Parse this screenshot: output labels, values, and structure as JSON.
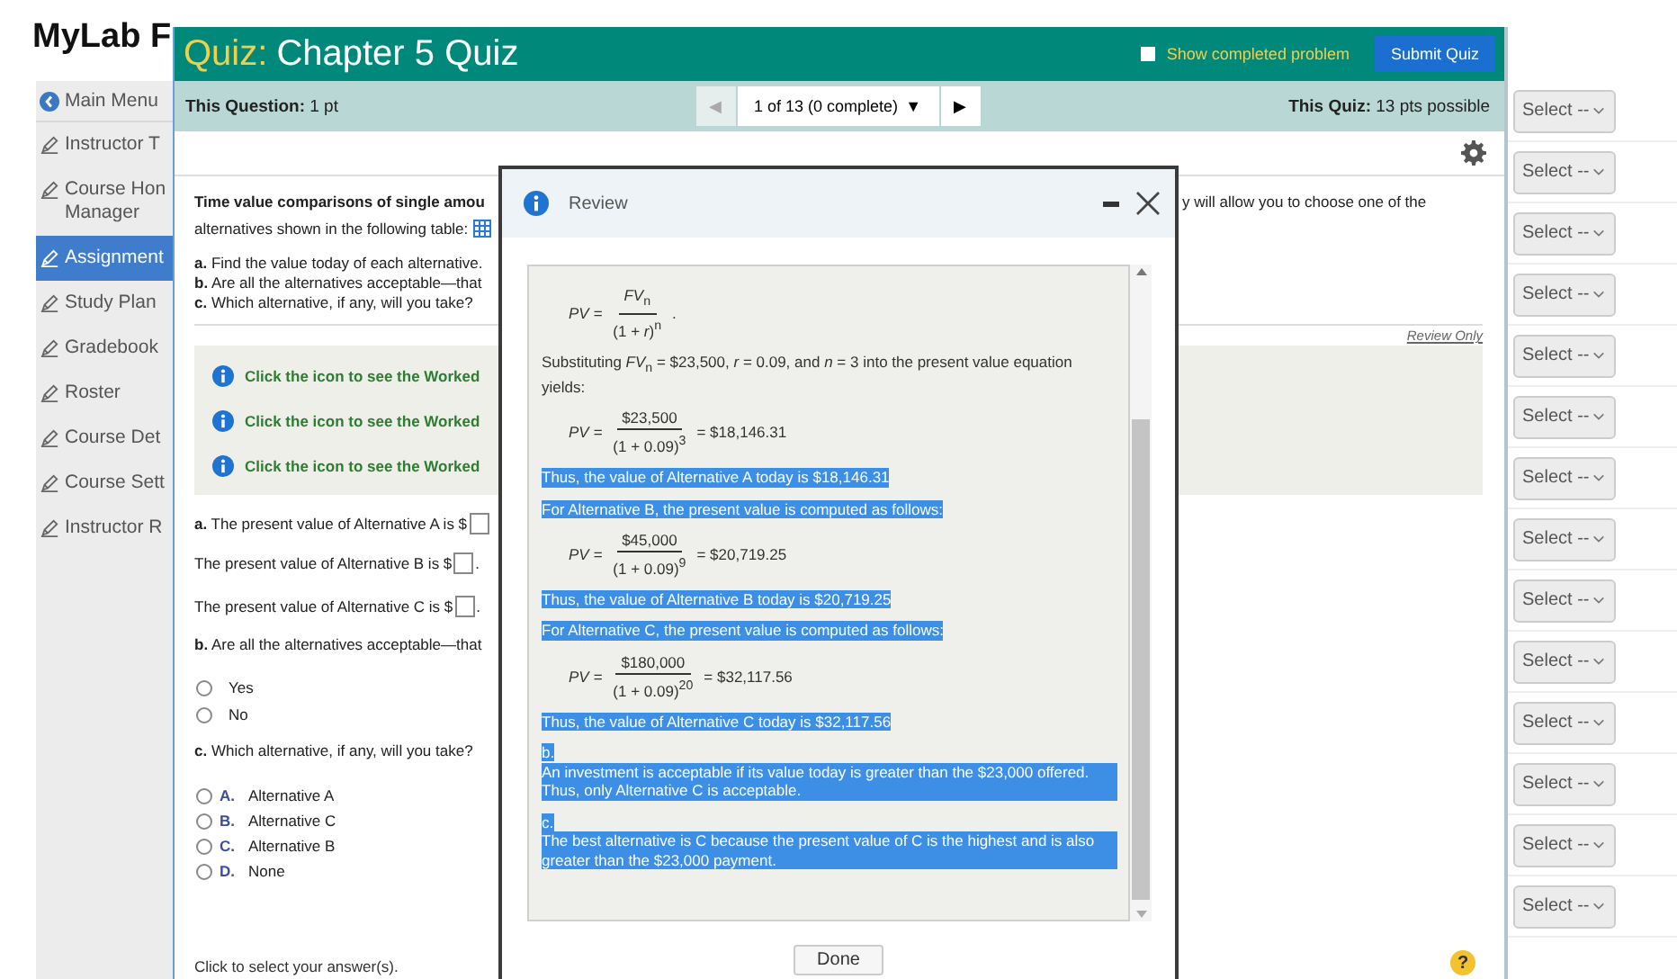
{
  "app": {
    "brand": "MyLab F"
  },
  "sidebar": {
    "items": [
      {
        "kind": "back",
        "label": "Main Menu",
        "selected": false
      },
      {
        "kind": "page",
        "label": "Instructor T",
        "selected": false
      },
      {
        "kind": "page",
        "label": "Course Hon Manager",
        "selected": false
      },
      {
        "kind": "page",
        "label": "Assignment",
        "selected": true
      },
      {
        "kind": "page",
        "label": "Study Plan",
        "selected": false
      },
      {
        "kind": "page",
        "label": "Gradebook",
        "selected": false
      },
      {
        "kind": "page",
        "label": "Roster",
        "selected": false
      },
      {
        "kind": "page",
        "label": "Course Det",
        "selected": false
      },
      {
        "kind": "page",
        "label": "Course Sett",
        "selected": false
      },
      {
        "kind": "page",
        "label": "Instructor R",
        "selected": false
      }
    ]
  },
  "select_column": {
    "selects": [
      {
        "label": "Select --"
      },
      {
        "label": "Select --"
      },
      {
        "label": "Select --"
      },
      {
        "label": "Select --"
      },
      {
        "label": "Select --"
      },
      {
        "label": "Select --"
      },
      {
        "label": "Select --"
      },
      {
        "label": "Select --"
      },
      {
        "label": "Select --"
      },
      {
        "label": "Select --"
      },
      {
        "label": "Select --"
      },
      {
        "label": "Select --"
      },
      {
        "label": "Select --"
      },
      {
        "label": "Select --"
      }
    ]
  },
  "quiz": {
    "title_prefix": "Quiz:",
    "title": "Chapter 5 Quiz",
    "show_completed": {
      "label": "Show completed problem",
      "checked": false
    },
    "submit": "Submit Quiz",
    "question_points": "**This Question:** 1 pt",
    "nav": {
      "prev": "◀",
      "prev_disabled": true,
      "position": "1 of 13 (0 complete)",
      "dropdown": "▼",
      "next": "▶"
    },
    "quiz_points": "**This Quiz:** 13 pts possible",
    "help": "?"
  },
  "question": {
    "intro_start": "Time value comparisons of single amou",
    "intro_end": "y will allow you to choose one of the",
    "intro_line2": "alternatives shown in the following table:",
    "tasks": [
      "**a.** Find the value today of each alternative.",
      "**b.** Are all the alternatives acceptable—that",
      "**c.** Which alternative, if any, will you take?"
    ],
    "review_label": "Review Only",
    "worked": [
      {
        "text": "Click the icon to see the Worked"
      },
      {
        "text": "Click the icon to see the Worked"
      },
      {
        "text": "Click the icon to see the Worked"
      }
    ],
    "amounts": [
      {
        "text": "**a.** The present value of Alternative A is $"
      },
      {
        "text": "The present value of Alternative B is $",
        "suffix": "."
      },
      {
        "text": "The present value of Alternative C is $",
        "suffix": "."
      }
    ],
    "part_b": "**b.** Are all the alternatives acceptable—that",
    "radios": [
      {
        "label": "Yes",
        "selected": false
      },
      {
        "label": "No",
        "selected": false
      }
    ],
    "part_c": "**c.** Which alternative, if any, will you take?",
    "choices": [
      {
        "letter": "A.",
        "label": "Alternative A",
        "selected": false
      },
      {
        "letter": "B.",
        "label": "Alternative C",
        "selected": false
      },
      {
        "letter": "C.",
        "label": "Alternative B",
        "selected": false
      },
      {
        "letter": "D.",
        "label": "None",
        "selected": false
      }
    ],
    "footer": "Click to select your answer(s)."
  },
  "review": {
    "title": "Review",
    "done": "Done",
    "blocks": [
      {
        "kind": "formula",
        "lhs": "PV =",
        "numerator": "*FV*$_{n}$",
        "denominator": "(1 + *r*)$^{n}$",
        "result": "."
      },
      {
        "kind": "text",
        "text": "Substituting *FV*$_{n}$ = $23,500, *r* = 0.09, and *n* = 3 into the present value equation yields:",
        "highlighted": false
      },
      {
        "kind": "formula",
        "lhs": "PV =",
        "numerator": "$23,500",
        "denominator": "(1 + 0.09)$^{3}$",
        "result": "= $18,146.31"
      },
      {
        "kind": "text",
        "text": "Thus, the value of Alternative A today is $18,146.31",
        "highlighted": true
      },
      {
        "kind": "text",
        "text": "For Alternative B, the present value is computed as follows:",
        "highlighted": true
      },
      {
        "kind": "formula",
        "lhs": "PV =",
        "numerator": "$45,000",
        "denominator": "(1 + 0.09)$^{9}$",
        "result": "= $20,719.25"
      },
      {
        "kind": "text",
        "text": "Thus, the value of Alternative B today is $20,719.25",
        "highlighted": true
      },
      {
        "kind": "text",
        "text": "For Alternative C, the present value is computed as follows:",
        "highlighted": true
      },
      {
        "kind": "formula",
        "lhs": "PV =",
        "numerator": "$180,000",
        "denominator": "(1 + 0.09)$^{20}$",
        "result": "= $32,117.56"
      },
      {
        "kind": "text",
        "text": "Thus, the value of Alternative C today is $32,117.56",
        "highlighted": true
      },
      {
        "kind": "label",
        "text": "b.",
        "highlighted": true
      },
      {
        "kind": "text",
        "text": "An investment is acceptable if its value today is greater than the $23,000 offered. Thus, only Alternative C is acceptable.",
        "highlighted": true
      },
      {
        "kind": "label",
        "text": "c.",
        "highlighted": true
      },
      {
        "kind": "text",
        "text": "The best alternative is C because the present value of C is the highest and is also greater than the $23,000 payment.",
        "highlighted": true
      }
    ]
  }
}
